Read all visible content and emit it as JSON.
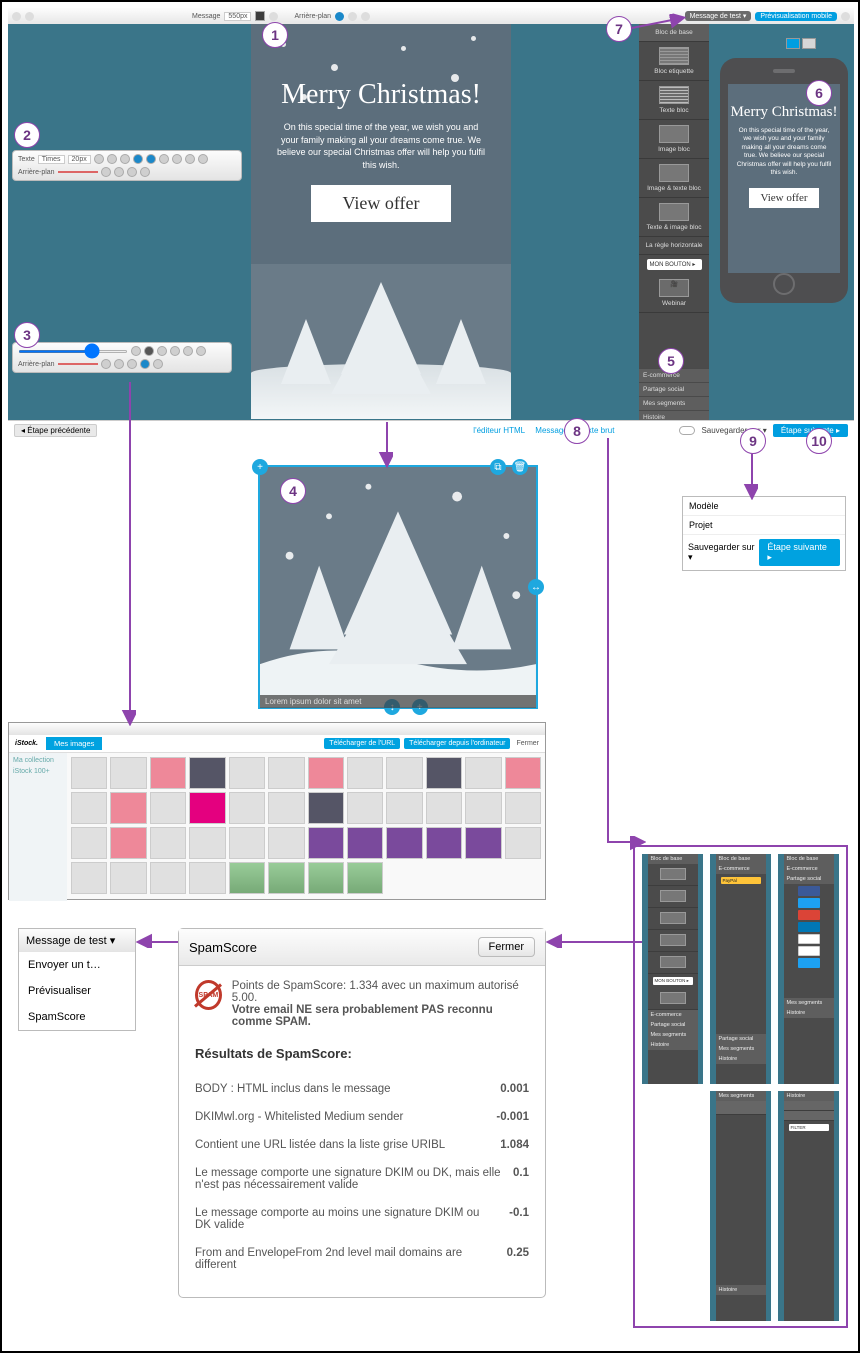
{
  "toolbar": {
    "label_message": "Message",
    "width_value": "550px",
    "label_arriere_plan": "Arrière-plan",
    "btn_test": "Message de test ▾",
    "btn_preview_mobile": "Prévisualisation mobile"
  },
  "canvas": {
    "title": "Merry Christmas!",
    "body": "On this special time of the year, we wish you and your family making all your dreams come true. We believe our special Christmas offer will help you fulfil this wish.",
    "cta": "View offer"
  },
  "blocks": {
    "header": "Bloc de base",
    "items": [
      {
        "label": "Bloc etiquette"
      },
      {
        "label": "Texte bloc"
      },
      {
        "label": "Image bloc"
      },
      {
        "label": "Image & texte bloc"
      },
      {
        "label": "Texte & image bloc"
      },
      {
        "label": "La règle horizontale"
      }
    ],
    "btn_mon_bouton": "MON BOUTON ▸",
    "webinar": "Webinar",
    "footer": [
      "E-commerce",
      "Partage social",
      "Mes segments",
      "Histoire"
    ]
  },
  "phone": {
    "title": "Merry Christmas!",
    "body": "On this special time of the year, we wish you and your family making all your dreams come true. We believe our special Christmas offer will help you fulfil this wish.",
    "cta": "View offer"
  },
  "bottom_bar": {
    "prev": "◂ Étape précédente",
    "link_html": "l'éditeur HTML",
    "link_brut": "Message en texte brut",
    "save": "Sauvegarder sur ▾",
    "next": "Étape suivante ▸"
  },
  "mini_tb2": {
    "row1_label": "Texte",
    "font": "Times",
    "size": "20px"
  },
  "mini_tb3": {
    "row2_label": "Arrière-plan"
  },
  "sel_caption": "Lorem ipsum dolor sit amet",
  "imgbrowser": {
    "logo": "iStock.",
    "tab": "Mes images",
    "btn_url": "Télécharger de l'URL",
    "btn_upload": "Télécharger depuis l'ordinateur",
    "btn_close": "Fermer",
    "side1": "Ma collection",
    "side2": "iStock 100+"
  },
  "dd": {
    "head": "Message de test ▾",
    "items": [
      "Envoyer un t…",
      "Prévisualiser",
      "SpamScore"
    ]
  },
  "spam": {
    "title": "SpamScore",
    "close": "Fermer",
    "intro1": "Points de SpamScore: 1.334 avec un maximum autorisé 5.00.",
    "intro2": "Votre email NE sera probablement PAS reconnu comme SPAM.",
    "results_title": "Résultats de SpamScore:",
    "rows": [
      {
        "label": "BODY : HTML inclus dans le message",
        "value": "0.001"
      },
      {
        "label": "DKIMwl.org - Whitelisted Medium sender",
        "value": "-0.001"
      },
      {
        "label": "Contient une URL listée dans la liste grise URIBL",
        "value": "1.084"
      },
      {
        "label": "Le message comporte une signature DKIM ou DK, mais elle n'est pas nécessairement valide",
        "value": "0.1"
      },
      {
        "label": "Le message comporte au moins une signature DKIM ou DK valide",
        "value": "-0.1"
      },
      {
        "label": "From and EnvelopeFrom 2nd level mail domains are different",
        "value": "0.25"
      }
    ]
  },
  "savebox": {
    "row1": "Modèle",
    "row2": "Projet",
    "save": "Sauvegarder sur ▾",
    "next": "Étape suivante ▸"
  },
  "panels_headers": [
    "Bloc de base",
    "E-commerce",
    "Partage social",
    "Mes segments",
    "Histoire"
  ],
  "badges": [
    "1",
    "2",
    "3",
    "4",
    "5",
    "6",
    "7",
    "8",
    "9",
    "10"
  ]
}
